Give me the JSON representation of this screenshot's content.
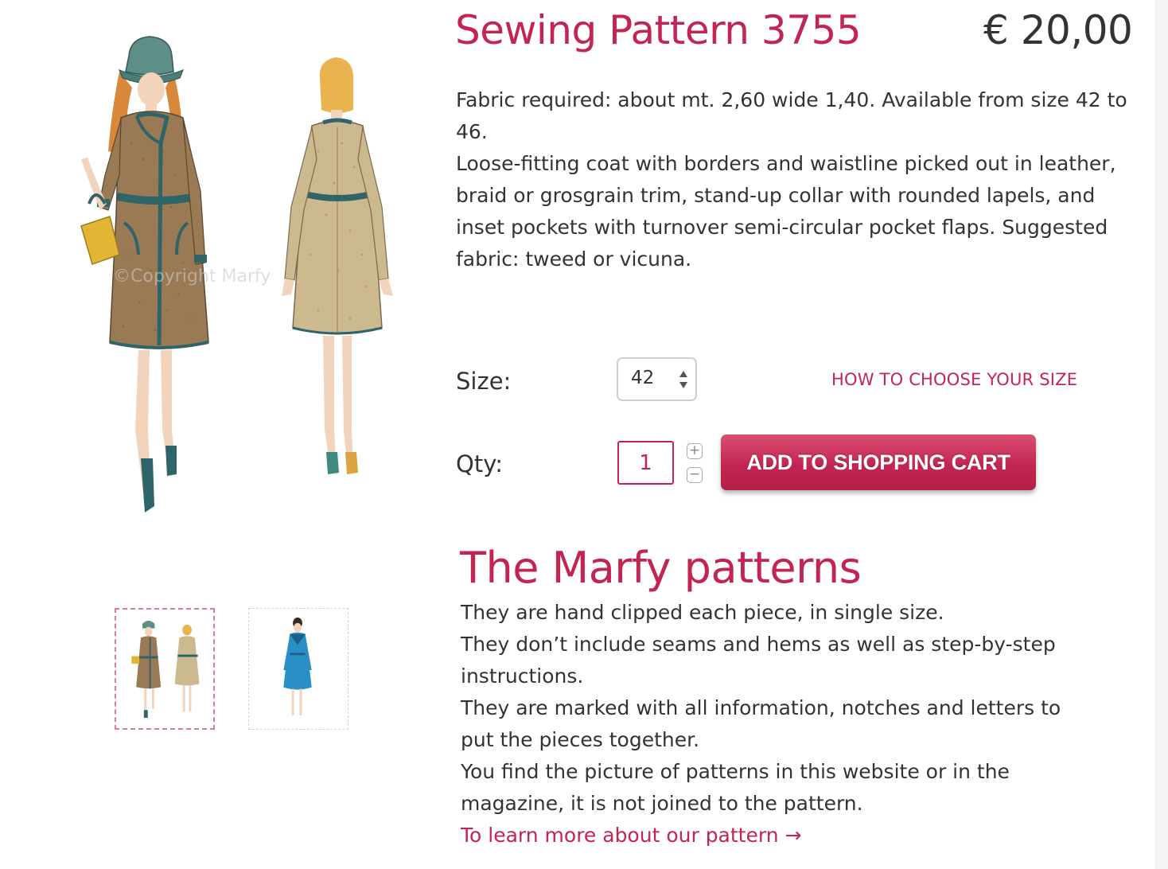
{
  "product": {
    "title": "Sewing Pattern 3755",
    "price": "€ 20,00",
    "description": [
      "Fabric required: about mt. 2,60 wide 1,40. Available from size 42 to 46.",
      "Loose-fitting coat with borders and waistline picked out in leather, braid or grosgrain trim, stand-up collar with rounded lapels, and inset pockets with turnover semi-circular pocket flaps. Suggested fabric: tweed or vicuna."
    ],
    "image_watermark": "©Copyright Marfy",
    "image_description": "Fashion illustration of a tweed coat, front and back views"
  },
  "size": {
    "label": "Size:",
    "selected": "42",
    "guide_link": "HOW TO CHOOSE YOUR SIZE"
  },
  "qty": {
    "label": "Qty:",
    "value": "1",
    "plus": "+",
    "minus": "−"
  },
  "cart": {
    "button_label": "ADD TO SHOPPING CART"
  },
  "marfy": {
    "heading": "The Marfy patterns",
    "paragraphs": [
      "They are hand clipped each piece, in single size.",
      "They don’t include seams and hems as well as step-by-step instructions.",
      "They are marked with all information, notches and letters to put the pieces together.",
      "You find the picture of patterns in this website or in the magazine, it is not joined to the pattern."
    ],
    "learn_more": "To learn more about our pattern →"
  },
  "thumbnails": [
    {
      "name": "coat front and back",
      "active": true
    },
    {
      "name": "blue coat",
      "active": false
    }
  ],
  "colors": {
    "accent": "#c32552",
    "text": "#333333",
    "thumb_border_active": "#e07a94",
    "coat_tweed": "#9a7a55",
    "trim": "#2f6468",
    "bag": "#e2b634",
    "blue_coat": "#2a8fc4"
  }
}
